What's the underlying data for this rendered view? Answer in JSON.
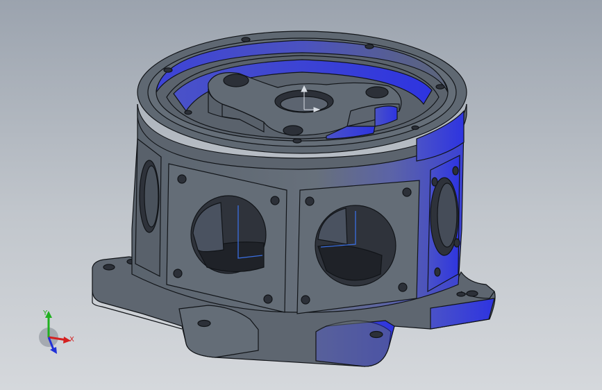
{
  "viewport": {
    "background_top": "#9ba3ae",
    "background_bottom": "#d5d8dc"
  },
  "model": {
    "body_color": "#5f6872",
    "edge_color": "#111418",
    "shaded_face_color": "#3d43d8",
    "hole_color": "#2c3038"
  },
  "triad": {
    "x_label": "X",
    "y_label": "Y",
    "z_label": "",
    "x_color": "#d42020",
    "y_color": "#20b020",
    "z_color": "#2030d8",
    "pivot_icon": "view-rotation-sphere"
  }
}
